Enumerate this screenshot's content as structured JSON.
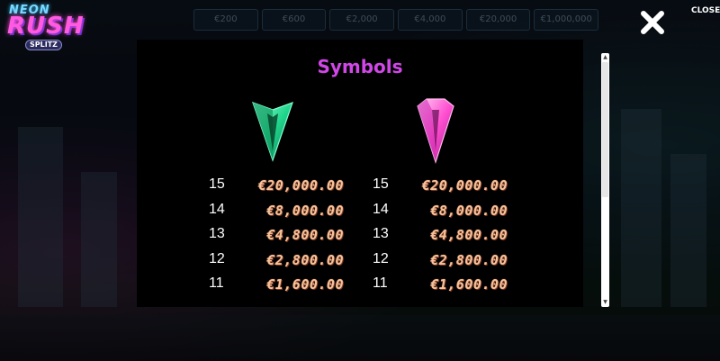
{
  "game": {
    "logo_line1": "NEON",
    "logo_line2": "RUSH",
    "logo_line3": "SPLITZ"
  },
  "prize_strip": [
    "€200",
    "€600",
    "€2,000",
    "€4,000",
    "€20,000",
    "€1,000,000"
  ],
  "close_label": "CLOSE",
  "paytable": {
    "title": "Symbols",
    "symbols": [
      {
        "icon": "green-crystal-icon",
        "color": "#2ef2a0",
        "rows": [
          {
            "count": "15",
            "value": "€20,000.00"
          },
          {
            "count": "14",
            "value": "€8,000.00"
          },
          {
            "count": "13",
            "value": "€4,800.00"
          },
          {
            "count": "12",
            "value": "€2,800.00"
          },
          {
            "count": "11",
            "value": "€1,600.00"
          }
        ]
      },
      {
        "icon": "pink-crystal-icon",
        "color": "#ff4fd0",
        "rows": [
          {
            "count": "15",
            "value": "€20,000.00"
          },
          {
            "count": "14",
            "value": "€8,000.00"
          },
          {
            "count": "13",
            "value": "€4,800.00"
          },
          {
            "count": "12",
            "value": "€2,800.00"
          },
          {
            "count": "11",
            "value": "€1,600.00"
          }
        ]
      }
    ]
  },
  "colors": {
    "title": "#d147e8",
    "payout": "#f6c39a",
    "panel": "#000000"
  }
}
